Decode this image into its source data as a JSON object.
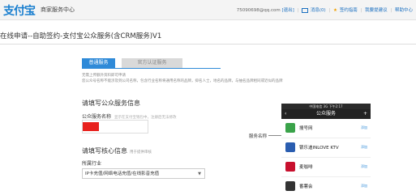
{
  "header": {
    "logo_text": "支付宝",
    "logo_subtitle": "商家服务中心",
    "account": "75090698@qq.com",
    "logout": "[退出]",
    "messages": "消息(0)",
    "signup_guide": "签约指南",
    "help": "帮助中心",
    "suggestions": "我要提建议"
  },
  "page": {
    "title": "在线申请--自助签约-支付宝公众服务(含CRM服务)V1"
  },
  "tabs": [
    {
      "label": "普通服务",
      "active": true
    },
    {
      "label": "官方认证服务",
      "active": false
    }
  ],
  "notice": {
    "line1": "无需上传额外资料即可申请",
    "line2": "您公众号名称不能涉及到公司名称，包含行业名称将通用名称的品牌，抑名人士，地名的品牌，与抽名品牌相同或近似的品牌"
  },
  "service_info": {
    "heading": "请填写公众服务信息",
    "name_label": "公众服务名称",
    "name_hint": "显示在支付宝钱包中，注册后无法修改"
  },
  "core_info": {
    "heading": "请填写核心信息",
    "heading_note": "用于提供审核",
    "industry_label": "所属行业",
    "industry_value": "IP卡充值/网络电话充值/在线影音充值"
  },
  "phone_preview": {
    "status_text": "中国电信  3G  下午2:17",
    "nav_title": "公众服务",
    "callout": "服务名称",
    "items": [
      {
        "name": "搜号网",
        "action": "添加",
        "color": "#3aa34a"
      },
      {
        "name": "银乐迪INLOVE KTV",
        "action": "添加",
        "color": "#2a5db0"
      },
      {
        "name": "麦咖啡",
        "action": "添加",
        "color": "#c8102e"
      },
      {
        "name": "番薯会",
        "action": "添加",
        "color": "#333333"
      }
    ]
  }
}
